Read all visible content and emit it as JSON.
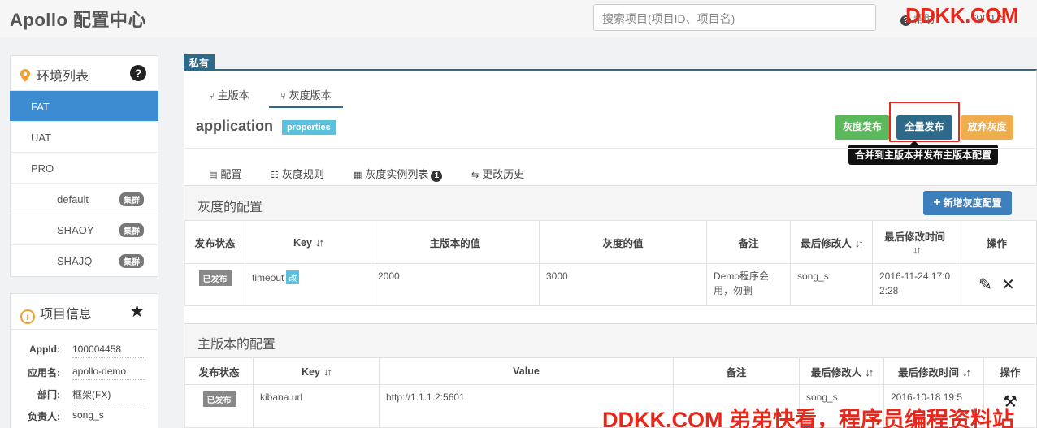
{
  "header": {
    "brand": "Apollo 配置中心",
    "search_placeholder": "搜索项目(项目ID、项目名)",
    "help_label": "帮助",
    "user": "song_s",
    "watermark_top": "DDKK.COM",
    "watermark_bottom": "DDKK.COM 弟弟快看，程序员编程资料站"
  },
  "sidebar": {
    "env_title": "环境列表",
    "help_icon": "?",
    "envs": [
      {
        "label": "FAT",
        "active": true
      },
      {
        "label": "UAT"
      },
      {
        "label": "PRO"
      }
    ],
    "clusters": [
      {
        "label": "default",
        "badge": "集群"
      },
      {
        "label": "SHAOY",
        "badge": "集群"
      },
      {
        "label": "SHAJQ",
        "badge": "集群"
      }
    ],
    "project_title": "项目信息",
    "project": [
      {
        "key": "AppId:",
        "value": "100004458"
      },
      {
        "key": "应用名:",
        "value": "apollo-demo"
      },
      {
        "key": "部门:",
        "value": "框架(FX)"
      },
      {
        "key": "负责人:",
        "value": "song_s"
      }
    ]
  },
  "main": {
    "private_tag": "私有",
    "version_tabs": [
      "主版本",
      "灰度版本"
    ],
    "namespace": "application",
    "format": "properties",
    "buttons": {
      "gray_publish": "灰度发布",
      "full_publish": "全量发布",
      "abandon_gray": "放弃灰度"
    },
    "tooltip": "合并到主版本并发布主版本配置",
    "content_tabs": [
      "配置",
      "灰度规则",
      "灰度实例列表",
      "更改历史"
    ],
    "instance_count": "1",
    "gray_section": {
      "title": "灰度的配置",
      "add_button": "新增灰度配置",
      "headers": [
        "发布状态",
        "Key",
        "主版本的值",
        "灰度的值",
        "备注",
        "最后修改人",
        "最后修改时间",
        "操作"
      ],
      "rows": [
        {
          "status": "已发布",
          "key": "timeout",
          "key_tag": "改",
          "master_value": "2000",
          "gray_value": "3000",
          "comment": "Demo程序会用，勿删",
          "modifier": "song_s",
          "time": "2016-11-24 17:02:28"
        }
      ]
    },
    "master_section": {
      "title": "主版本的配置",
      "headers": [
        "发布状态",
        "Key",
        "Value",
        "备注",
        "最后修改人",
        "最后修改时间",
        "操作"
      ],
      "rows": [
        {
          "status": "已发布",
          "key": "kibana.url",
          "value": "http://1.1.1.2:5601",
          "comment": "",
          "modifier": "song_s",
          "time": "2016-10-18 19:5"
        }
      ]
    }
  }
}
